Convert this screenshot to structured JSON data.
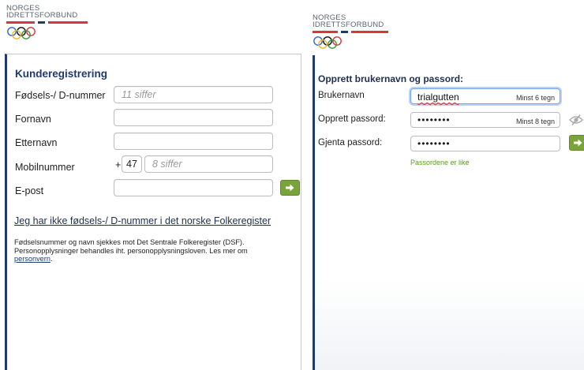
{
  "left_logo": {
    "line1": "NORGES",
    "line2": "IDRETTSFORBUND"
  },
  "right_logo": {
    "line1": "NORGES",
    "line2": "IDRETTSFORBUND"
  },
  "registration": {
    "title": "Kunderegistrering",
    "fields": [
      {
        "label": "Fødsels-/ D-nummer",
        "placeholder": "11 siffer",
        "value": ""
      },
      {
        "label": "Fornavn",
        "placeholder": "",
        "value": ""
      },
      {
        "label": "Etternavn",
        "placeholder": "",
        "value": ""
      },
      {
        "label": "Mobilnummer",
        "prefix_plus": "+",
        "country_code": "47",
        "placeholder": "8 siffer",
        "value": ""
      },
      {
        "label": "E-post",
        "placeholder": "",
        "value": ""
      }
    ],
    "no_number_link": "Jeg har ikke fødsels-/ D-nummer i det norske Folkeregister",
    "info_line1": "Fødselsnummer og navn sjekkes mot Det Sentrale Folkeregister (DSF).",
    "info_line2": "Personopplysninger behandles iht. personopplysningsloven. Les mer om",
    "info_link": "personvern",
    "info_end": "."
  },
  "account": {
    "title": "Opprett brukernavn og passord:",
    "username": {
      "label": "Brukernavn",
      "value": "trialgutten",
      "hint": "Minst 6 tegn"
    },
    "password": {
      "label": "Opprett passord:",
      "value": "••••••••",
      "hint": "Minst 8 tegn"
    },
    "repeat": {
      "label": "Gjenta passord:",
      "value": "••••••••"
    },
    "match_message": "Passordene er like"
  },
  "colors": {
    "brand_navy": "#1f3a6e",
    "flag_red": "#d4373c",
    "flag_blue": "#1f3a6e",
    "button_green": "#7aa33a",
    "success_green": "#5b9a2a"
  },
  "icons": {
    "submit": "arrow-right-icon",
    "toggle_visibility": "eye-off-icon"
  }
}
